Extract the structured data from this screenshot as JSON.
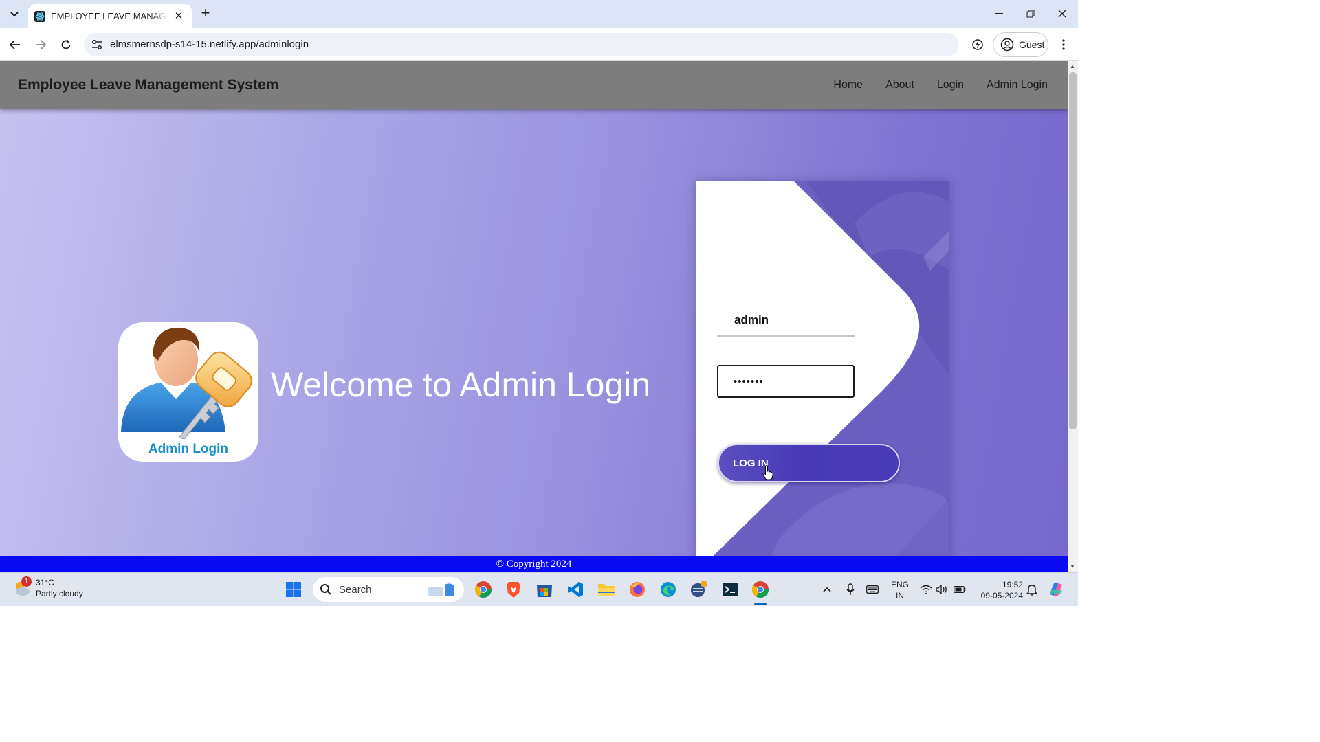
{
  "browser": {
    "tab_title": "EMPLOYEE LEAVE MANAGEMENT SYSTEM",
    "url": "elmsmernsdp-s14-15.netlify.app/adminlogin",
    "profile_label": "Guest"
  },
  "navbar": {
    "brand": "Employee Leave Management System",
    "links": [
      "Home",
      "About",
      "Login",
      "Admin Login"
    ]
  },
  "hero": {
    "logo_caption": "Admin Login",
    "welcome_text": "Welcome to Admin Login"
  },
  "login_form": {
    "username_value": "admin",
    "password_value": "•••••••",
    "submit_label": "LOG IN"
  },
  "footer": {
    "text": "© Copyright 2024"
  },
  "taskbar": {
    "weather_badge": "1",
    "temperature": "31°C",
    "weather_condition": "Partly cloudy",
    "search_label": "Search",
    "language_line1": "ENG",
    "language_line2": "IN",
    "time": "19:52",
    "date": "09-05-2024"
  },
  "colors": {
    "navbar_bg": "#7d7d7d",
    "footer_bg": "#0a0bf2",
    "card_accent": "#6b5fc1",
    "button_bg": "#4939b6",
    "logo_caption": "#1b8fc9"
  }
}
